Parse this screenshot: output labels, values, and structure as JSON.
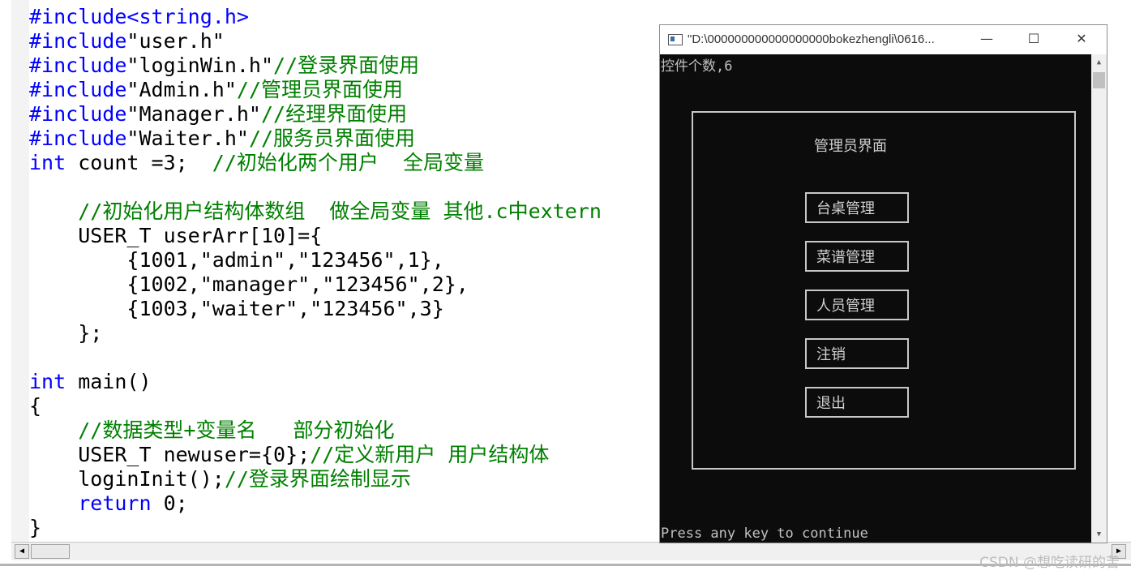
{
  "code_lines": [
    [
      {
        "t": "#include<string.h>",
        "c": "kw2"
      }
    ],
    [
      {
        "t": "#include",
        "c": "kw"
      },
      {
        "t": "\"user.h\"",
        "c": ""
      }
    ],
    [
      {
        "t": "#include",
        "c": "kw"
      },
      {
        "t": "\"loginWin.h\"",
        "c": ""
      },
      {
        "t": "//登录界面使用",
        "c": "cm"
      }
    ],
    [
      {
        "t": "#include",
        "c": "kw"
      },
      {
        "t": "\"Admin.h\"",
        "c": ""
      },
      {
        "t": "//管理员界面使用",
        "c": "cm"
      }
    ],
    [
      {
        "t": "#include",
        "c": "kw"
      },
      {
        "t": "\"Manager.h\"",
        "c": ""
      },
      {
        "t": "//经理界面使用",
        "c": "cm"
      }
    ],
    [
      {
        "t": "#include",
        "c": "kw"
      },
      {
        "t": "\"Waiter.h\"",
        "c": ""
      },
      {
        "t": "//服务员界面使用",
        "c": "cm"
      }
    ],
    [
      {
        "t": "int",
        "c": "kw"
      },
      {
        "t": " count =3;  ",
        "c": ""
      },
      {
        "t": "//初始化两个用户  全局变量",
        "c": "cm"
      }
    ],
    [
      {
        "t": "",
        "c": ""
      }
    ],
    [
      {
        "t": "    ",
        "c": ""
      },
      {
        "t": "//初始化用户结构体数组  做全局变量 其他.c中extern",
        "c": "cm"
      }
    ],
    [
      {
        "t": "    USER_T userArr[10]={",
        "c": ""
      }
    ],
    [
      {
        "t": "        {1001,\"admin\",\"123456\",1},",
        "c": ""
      }
    ],
    [
      {
        "t": "        {1002,\"manager\",\"123456\",2},",
        "c": ""
      }
    ],
    [
      {
        "t": "        {1003,\"waiter\",\"123456\",3}",
        "c": ""
      }
    ],
    [
      {
        "t": "    };",
        "c": ""
      }
    ],
    [
      {
        "t": "",
        "c": ""
      }
    ],
    [
      {
        "t": "int",
        "c": "kw"
      },
      {
        "t": " main()",
        "c": ""
      }
    ],
    [
      {
        "t": "{",
        "c": ""
      }
    ],
    [
      {
        "t": "    ",
        "c": ""
      },
      {
        "t": "//数据类型+变量名   部分初始化",
        "c": "cm"
      }
    ],
    [
      {
        "t": "    USER_T newuser={0};",
        "c": ""
      },
      {
        "t": "//定义新用户 用户结构体",
        "c": "cm"
      }
    ],
    [
      {
        "t": "    loginInit();",
        "c": ""
      },
      {
        "t": "//登录界面绘制显示",
        "c": "cm"
      }
    ],
    [
      {
        "t": "    ",
        "c": ""
      },
      {
        "t": "return",
        "c": "kw"
      },
      {
        "t": " 0;",
        "c": ""
      }
    ],
    [
      {
        "t": "}",
        "c": ""
      }
    ]
  ],
  "console": {
    "title": "\"D:\\000000000000000000bokezhengli\\0616...",
    "min_glyph": "—",
    "max_glyph": "☐",
    "close_glyph": "✕",
    "count_text": "控件个数,6",
    "frame_title": "管理员界面",
    "buttons": [
      "台桌管理",
      "菜谱管理",
      "人员管理",
      "注销",
      "退出"
    ],
    "press_text": "Press any key to continue"
  },
  "scroll": {
    "left_arrow": "◀",
    "right_arrow": "▶",
    "up_arrow": "▲",
    "down_arrow": "▼"
  },
  "watermark": "CSDN @想吃读研的苦",
  "colors": {
    "keyword": "#0000ff",
    "comment": "#008000",
    "console_bg": "#0c0c0c",
    "console_text": "#c0c0c0"
  }
}
